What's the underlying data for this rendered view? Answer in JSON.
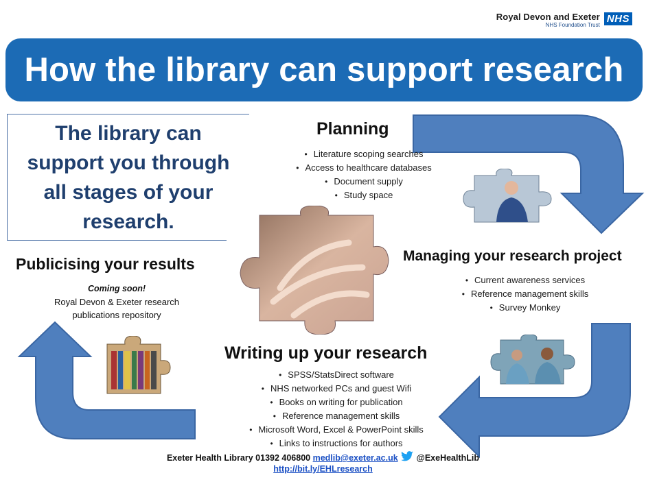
{
  "logo": {
    "trust_name": "Royal Devon and Exeter",
    "trust_sub": "NHS Foundation Trust",
    "nhs": "NHS"
  },
  "title": "How the library can support research",
  "intro": "The library can support you through all stages of your research.",
  "planning": {
    "heading": "Planning",
    "items": [
      "Literature scoping searches",
      "Access to healthcare databases",
      "Document supply",
      "Study space"
    ]
  },
  "managing": {
    "heading": "Managing your research project",
    "items": [
      "Current awareness services",
      "Reference management skills",
      "Survey Monkey"
    ]
  },
  "writing": {
    "heading": "Writing up your research",
    "items": [
      "SPSS/StatsDirect software",
      "NHS networked  PCs and guest Wifi",
      "Books on writing for publication",
      "Reference management skills",
      "Microsoft Word, Excel & PowerPoint skills",
      "Links to instructions for authors"
    ]
  },
  "publicising": {
    "heading": "Publicising your results",
    "coming": "Coming soon!",
    "line1": "Royal Devon & Exeter research",
    "line2": "publications repository"
  },
  "footer": {
    "contact": "Exeter Health Library 01392 406800",
    "email": "medlib@exeter.ac.uk",
    "twitter": "@ExeHealthLib",
    "url": "http://bit.ly/EHLresearch"
  },
  "colors": {
    "banner": "#1c6bb5",
    "arrow": "#4f7fbe",
    "arrow_stroke": "#3a66a3",
    "intro_text": "#1f3f6e"
  },
  "icons": [
    "twitter-bird-icon",
    "puzzle-hands-icon",
    "puzzle-nurse-icon",
    "puzzle-surgeons-icon",
    "puzzle-books-icon"
  ]
}
